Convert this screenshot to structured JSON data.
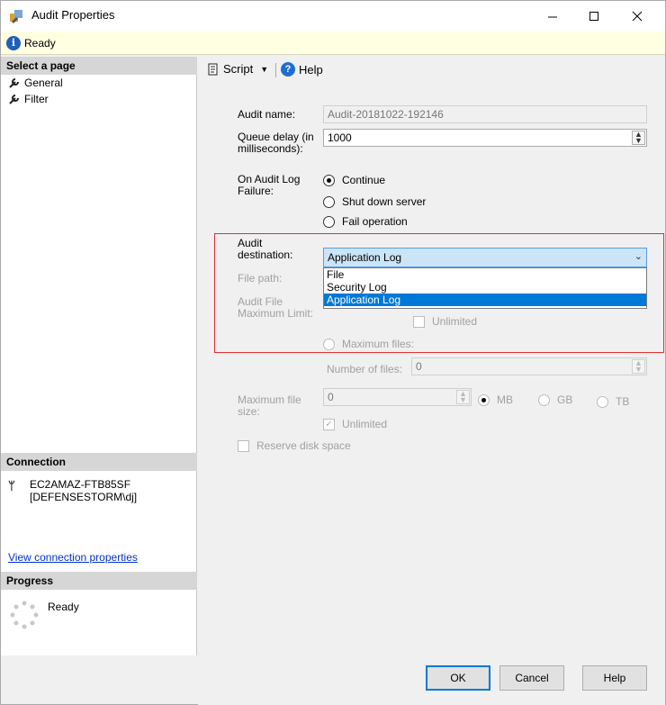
{
  "window": {
    "title": "Audit Properties"
  },
  "status": {
    "text": "Ready"
  },
  "left": {
    "select_page_header": "Select a page",
    "pages": [
      "General",
      "Filter"
    ],
    "connection_header": "Connection",
    "connection_server": "EC2AMAZ-FTB85SF",
    "connection_user": "[DEFENSESTORM\\dj]",
    "view_connection_link": "View connection properties",
    "progress_header": "Progress",
    "progress_text": "Ready"
  },
  "toolbar": {
    "script_label": "Script",
    "help_label": "Help"
  },
  "form": {
    "audit_name_label": "Audit name:",
    "audit_name_value": "Audit-20181022-192146",
    "queue_delay_label_1": "Queue delay (in",
    "queue_delay_label_2": "milliseconds):",
    "queue_delay_value": "1000",
    "on_failure_label_1": "On Audit Log",
    "on_failure_label_2": "Failure:",
    "radio_continue": "Continue",
    "radio_shutdown": "Shut down server",
    "radio_fail": "Fail operation",
    "destination_label_1": "Audit",
    "destination_label_2": "destination:",
    "destination_selected": "Application Log",
    "destination_options": [
      "File",
      "Security Log",
      "Application Log"
    ],
    "file_path_label": "File path:",
    "max_limit_label_1": "Audit File",
    "max_limit_label_2": "Maximum Limit:",
    "unlimited_label": "Unlimited",
    "max_files_label": "Maximum files:",
    "number_of_files_label": "Number of files:",
    "number_of_files_value": "0",
    "max_file_size_label_1": "Maximum file",
    "max_file_size_label_2": "size:",
    "max_file_size_value": "0",
    "unit_mb": "MB",
    "unit_gb": "GB",
    "unit_tb": "TB",
    "size_unlimited_label": "Unlimited",
    "reserve_disk_label": "Reserve disk space"
  },
  "buttons": {
    "ok": "OK",
    "cancel": "Cancel",
    "help": "Help"
  }
}
